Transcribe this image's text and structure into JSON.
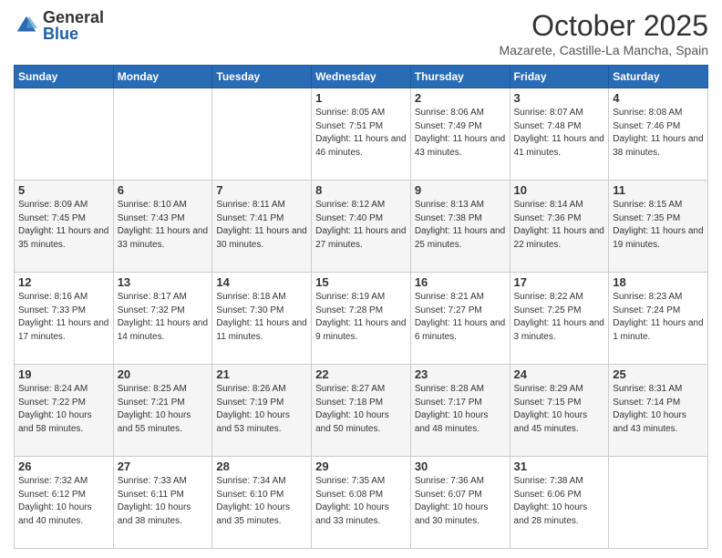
{
  "header": {
    "logo": {
      "general": "General",
      "blue": "Blue"
    },
    "title": "October 2025",
    "location": "Mazarete, Castille-La Mancha, Spain"
  },
  "days_of_week": [
    "Sunday",
    "Monday",
    "Tuesday",
    "Wednesday",
    "Thursday",
    "Friday",
    "Saturday"
  ],
  "weeks": [
    [
      {
        "day": "",
        "sunrise": "",
        "sunset": "",
        "daylight": ""
      },
      {
        "day": "",
        "sunrise": "",
        "sunset": "",
        "daylight": ""
      },
      {
        "day": "",
        "sunrise": "",
        "sunset": "",
        "daylight": ""
      },
      {
        "day": "1",
        "sunrise": "Sunrise: 8:05 AM",
        "sunset": "Sunset: 7:51 PM",
        "daylight": "Daylight: 11 hours and 46 minutes."
      },
      {
        "day": "2",
        "sunrise": "Sunrise: 8:06 AM",
        "sunset": "Sunset: 7:49 PM",
        "daylight": "Daylight: 11 hours and 43 minutes."
      },
      {
        "day": "3",
        "sunrise": "Sunrise: 8:07 AM",
        "sunset": "Sunset: 7:48 PM",
        "daylight": "Daylight: 11 hours and 41 minutes."
      },
      {
        "day": "4",
        "sunrise": "Sunrise: 8:08 AM",
        "sunset": "Sunset: 7:46 PM",
        "daylight": "Daylight: 11 hours and 38 minutes."
      }
    ],
    [
      {
        "day": "5",
        "sunrise": "Sunrise: 8:09 AM",
        "sunset": "Sunset: 7:45 PM",
        "daylight": "Daylight: 11 hours and 35 minutes."
      },
      {
        "day": "6",
        "sunrise": "Sunrise: 8:10 AM",
        "sunset": "Sunset: 7:43 PM",
        "daylight": "Daylight: 11 hours and 33 minutes."
      },
      {
        "day": "7",
        "sunrise": "Sunrise: 8:11 AM",
        "sunset": "Sunset: 7:41 PM",
        "daylight": "Daylight: 11 hours and 30 minutes."
      },
      {
        "day": "8",
        "sunrise": "Sunrise: 8:12 AM",
        "sunset": "Sunset: 7:40 PM",
        "daylight": "Daylight: 11 hours and 27 minutes."
      },
      {
        "day": "9",
        "sunrise": "Sunrise: 8:13 AM",
        "sunset": "Sunset: 7:38 PM",
        "daylight": "Daylight: 11 hours and 25 minutes."
      },
      {
        "day": "10",
        "sunrise": "Sunrise: 8:14 AM",
        "sunset": "Sunset: 7:36 PM",
        "daylight": "Daylight: 11 hours and 22 minutes."
      },
      {
        "day": "11",
        "sunrise": "Sunrise: 8:15 AM",
        "sunset": "Sunset: 7:35 PM",
        "daylight": "Daylight: 11 hours and 19 minutes."
      }
    ],
    [
      {
        "day": "12",
        "sunrise": "Sunrise: 8:16 AM",
        "sunset": "Sunset: 7:33 PM",
        "daylight": "Daylight: 11 hours and 17 minutes."
      },
      {
        "day": "13",
        "sunrise": "Sunrise: 8:17 AM",
        "sunset": "Sunset: 7:32 PM",
        "daylight": "Daylight: 11 hours and 14 minutes."
      },
      {
        "day": "14",
        "sunrise": "Sunrise: 8:18 AM",
        "sunset": "Sunset: 7:30 PM",
        "daylight": "Daylight: 11 hours and 11 minutes."
      },
      {
        "day": "15",
        "sunrise": "Sunrise: 8:19 AM",
        "sunset": "Sunset: 7:28 PM",
        "daylight": "Daylight: 11 hours and 9 minutes."
      },
      {
        "day": "16",
        "sunrise": "Sunrise: 8:21 AM",
        "sunset": "Sunset: 7:27 PM",
        "daylight": "Daylight: 11 hours and 6 minutes."
      },
      {
        "day": "17",
        "sunrise": "Sunrise: 8:22 AM",
        "sunset": "Sunset: 7:25 PM",
        "daylight": "Daylight: 11 hours and 3 minutes."
      },
      {
        "day": "18",
        "sunrise": "Sunrise: 8:23 AM",
        "sunset": "Sunset: 7:24 PM",
        "daylight": "Daylight: 11 hours and 1 minute."
      }
    ],
    [
      {
        "day": "19",
        "sunrise": "Sunrise: 8:24 AM",
        "sunset": "Sunset: 7:22 PM",
        "daylight": "Daylight: 10 hours and 58 minutes."
      },
      {
        "day": "20",
        "sunrise": "Sunrise: 8:25 AM",
        "sunset": "Sunset: 7:21 PM",
        "daylight": "Daylight: 10 hours and 55 minutes."
      },
      {
        "day": "21",
        "sunrise": "Sunrise: 8:26 AM",
        "sunset": "Sunset: 7:19 PM",
        "daylight": "Daylight: 10 hours and 53 minutes."
      },
      {
        "day": "22",
        "sunrise": "Sunrise: 8:27 AM",
        "sunset": "Sunset: 7:18 PM",
        "daylight": "Daylight: 10 hours and 50 minutes."
      },
      {
        "day": "23",
        "sunrise": "Sunrise: 8:28 AM",
        "sunset": "Sunset: 7:17 PM",
        "daylight": "Daylight: 10 hours and 48 minutes."
      },
      {
        "day": "24",
        "sunrise": "Sunrise: 8:29 AM",
        "sunset": "Sunset: 7:15 PM",
        "daylight": "Daylight: 10 hours and 45 minutes."
      },
      {
        "day": "25",
        "sunrise": "Sunrise: 8:31 AM",
        "sunset": "Sunset: 7:14 PM",
        "daylight": "Daylight: 10 hours and 43 minutes."
      }
    ],
    [
      {
        "day": "26",
        "sunrise": "Sunrise: 7:32 AM",
        "sunset": "Sunset: 6:12 PM",
        "daylight": "Daylight: 10 hours and 40 minutes."
      },
      {
        "day": "27",
        "sunrise": "Sunrise: 7:33 AM",
        "sunset": "Sunset: 6:11 PM",
        "daylight": "Daylight: 10 hours and 38 minutes."
      },
      {
        "day": "28",
        "sunrise": "Sunrise: 7:34 AM",
        "sunset": "Sunset: 6:10 PM",
        "daylight": "Daylight: 10 hours and 35 minutes."
      },
      {
        "day": "29",
        "sunrise": "Sunrise: 7:35 AM",
        "sunset": "Sunset: 6:08 PM",
        "daylight": "Daylight: 10 hours and 33 minutes."
      },
      {
        "day": "30",
        "sunrise": "Sunrise: 7:36 AM",
        "sunset": "Sunset: 6:07 PM",
        "daylight": "Daylight: 10 hours and 30 minutes."
      },
      {
        "day": "31",
        "sunrise": "Sunrise: 7:38 AM",
        "sunset": "Sunset: 6:06 PM",
        "daylight": "Daylight: 10 hours and 28 minutes."
      },
      {
        "day": "",
        "sunrise": "",
        "sunset": "",
        "daylight": ""
      }
    ]
  ]
}
